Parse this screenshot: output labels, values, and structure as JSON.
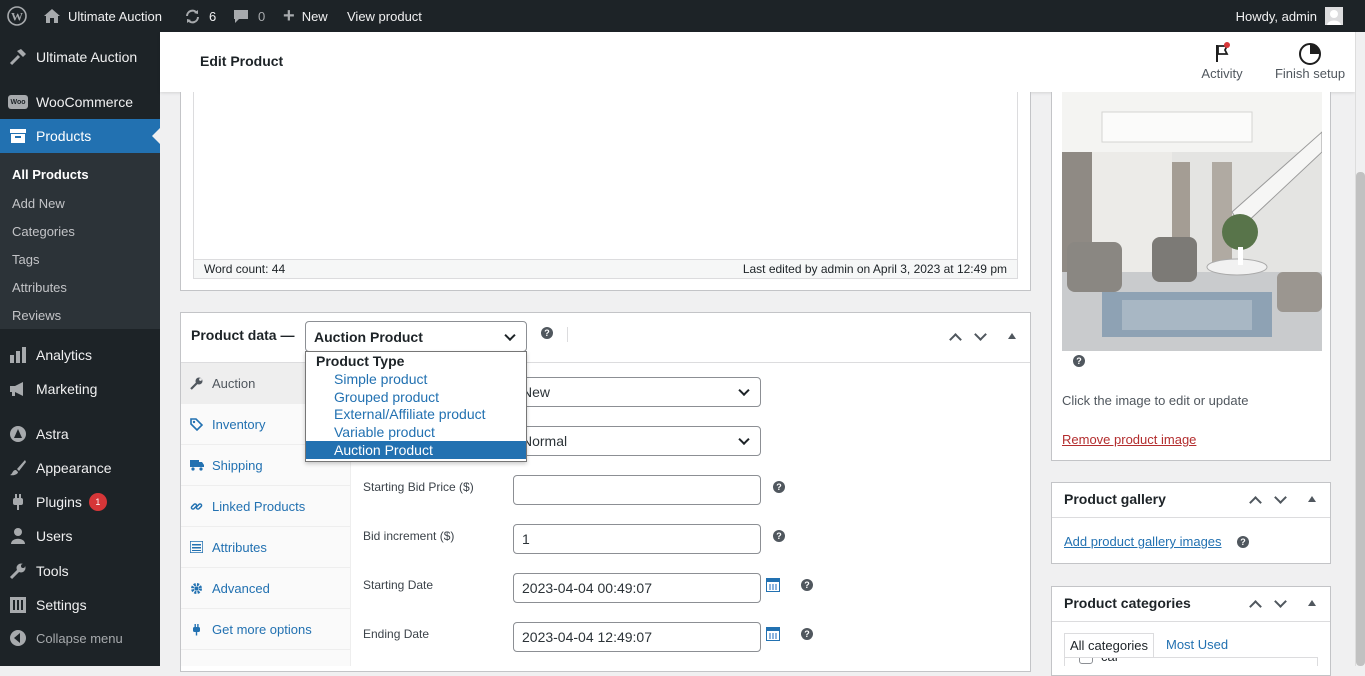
{
  "adminbar": {
    "site_name": "Ultimate Auction",
    "updates_count": "6",
    "comments_count": "0",
    "new_label": "New",
    "view_label": "View product",
    "howdy": "Howdy, admin"
  },
  "sidebar": {
    "items": [
      {
        "label": "Ultimate Auction",
        "icon": "hammer-icon"
      },
      {
        "label": "WooCommerce",
        "icon": "woo-icon"
      },
      {
        "label": "Products",
        "icon": "archive-icon"
      },
      {
        "label": "Analytics",
        "icon": "bar-chart-icon"
      },
      {
        "label": "Marketing",
        "icon": "megaphone-icon"
      },
      {
        "label": "Astra",
        "icon": "astra-icon"
      },
      {
        "label": "Appearance",
        "icon": "paintbrush-icon"
      },
      {
        "label": "Plugins",
        "icon": "plug-icon",
        "badge": "1"
      },
      {
        "label": "Users",
        "icon": "user-icon"
      },
      {
        "label": "Tools",
        "icon": "wrench-icon"
      },
      {
        "label": "Settings",
        "icon": "settings-icon"
      },
      {
        "label": "Collapse menu",
        "icon": "collapse-icon"
      }
    ],
    "submenu": [
      "All Products",
      "Add New",
      "Categories",
      "Tags",
      "Attributes",
      "Reviews"
    ]
  },
  "topbar": {
    "title": "Edit Product",
    "activity": "Activity",
    "finish_setup": "Finish setup"
  },
  "editor": {
    "word_count": "Word count: 44",
    "last_edited": "Last edited by admin on April 3, 2023 at 12:49 pm"
  },
  "product_data": {
    "label": "Product data —",
    "selected_type": "Auction Product",
    "dropdown": {
      "group_label": "Product Type",
      "options": [
        "Simple product",
        "Grouped product",
        "External/Affiliate product",
        "Variable product",
        "Auction Product"
      ],
      "highlighted": "Auction Product"
    },
    "tabs": [
      "Auction",
      "Inventory",
      "Shipping",
      "Linked Products",
      "Attributes",
      "Advanced",
      "Get more options"
    ],
    "fields": {
      "condition_value": "New",
      "type_value": "Normal",
      "starting_bid_label": "Starting Bid Price ($)",
      "starting_bid_value": "",
      "bid_increment_label": "Bid increment ($)",
      "bid_increment_value": "1",
      "starting_date_label": "Starting Date",
      "starting_date_value": "2023-04-04 00:49:07",
      "ending_date_label": "Ending Date",
      "ending_date_value": "2023-04-04 12:49:07"
    }
  },
  "product_image": {
    "caption": "Click the image to edit or update",
    "remove_link": "Remove product image"
  },
  "gallery": {
    "title": "Product gallery",
    "add_link": "Add product gallery images"
  },
  "categories": {
    "title": "Product categories",
    "tab_all": "All categories",
    "tab_most_used": "Most Used",
    "partial_item": "car"
  },
  "colors": {
    "admin_dark": "#1d2327",
    "accent": "#2271b1",
    "highlight": "#2271b1",
    "badge": "#d63638"
  }
}
